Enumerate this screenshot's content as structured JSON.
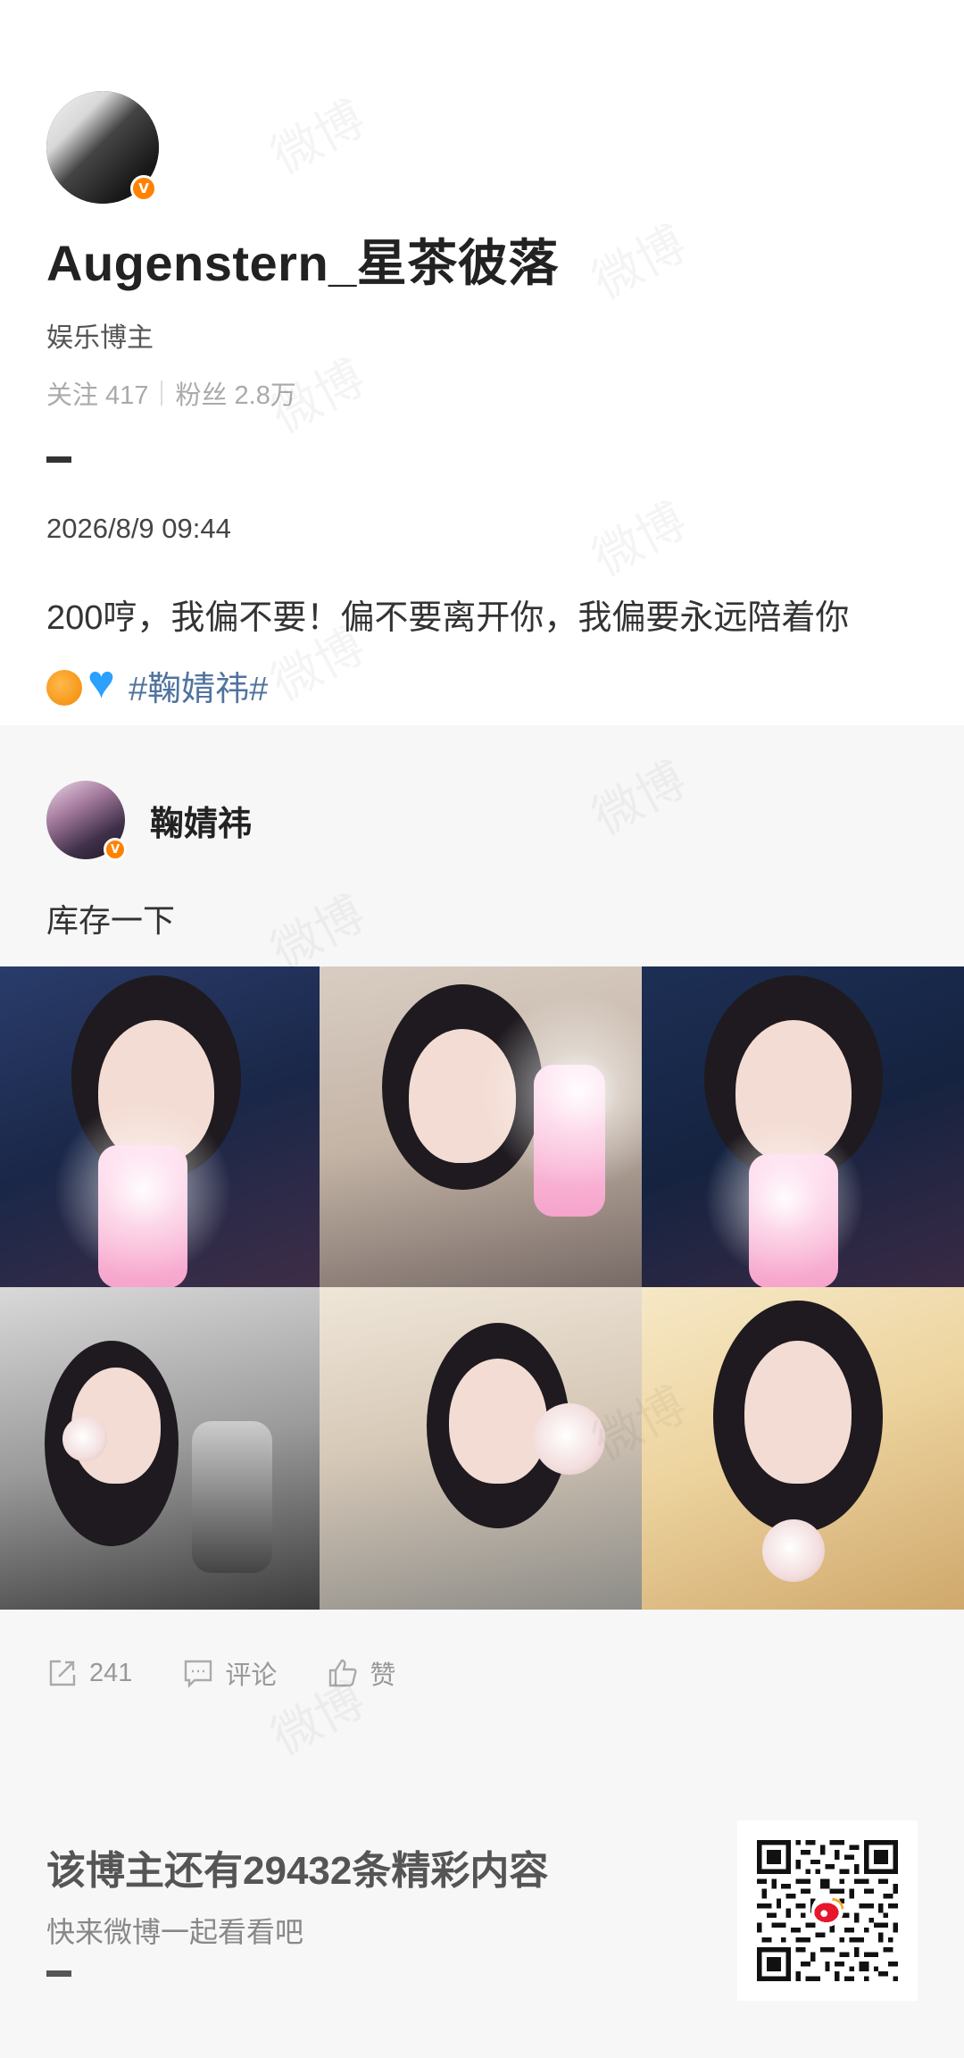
{
  "author": {
    "name": "Augenstern_星茶彼落",
    "role": "娱乐博主",
    "badge": "V",
    "following_label": "关注 417",
    "followers_label": "粉丝 2.8万"
  },
  "post": {
    "timestamp": "2026/8/9 09:44",
    "text": "200哼，我偏不要！偏不要离开你，我偏要永远陪着你",
    "hashtag": "#鞠婧祎#"
  },
  "repost": {
    "author_name": "鞠婧祎",
    "badge": "V",
    "text": "库存一下",
    "photo_count": 6
  },
  "actions": {
    "share_count": "241",
    "comment_label": "评论",
    "like_label": "赞"
  },
  "footer": {
    "title": "该博主还有29432条精彩内容",
    "subtitle": "快来微博一起看看吧"
  },
  "watermark": "微博",
  "colors": {
    "accent_orange": "#ff8200",
    "hashtag_blue": "#50739f",
    "section_bg": "#f7f7f7"
  }
}
